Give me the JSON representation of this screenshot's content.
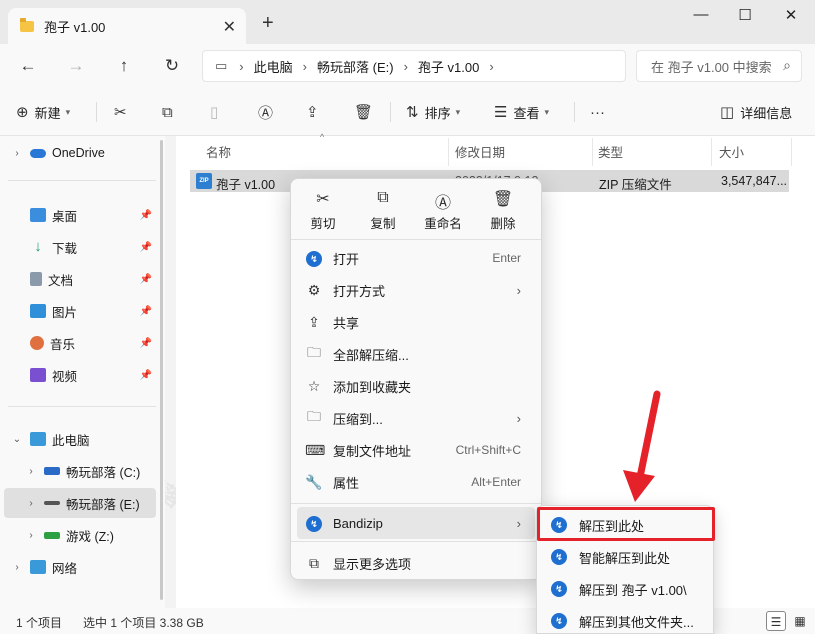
{
  "window": {
    "tab_title": "孢子 v1.00",
    "new_tab": "+",
    "controls": {
      "minimize": "—",
      "maximize": "☐",
      "close": "✕"
    }
  },
  "nav": {
    "back": "←",
    "forward": "→",
    "up": "↑",
    "refresh": "↻",
    "breadcrumbs": [
      "此电脑",
      "畅玩部落 (E:)",
      "孢子 v1.00"
    ],
    "search_placeholder": "在 孢子 v1.00 中搜索"
  },
  "commands": {
    "new": "新建",
    "sort": "排序",
    "view": "查看",
    "details": "详细信息"
  },
  "sidebar": {
    "onedrive": "OneDrive",
    "quick": [
      {
        "label": "桌面",
        "icon": "desktop-icon",
        "color": "#3b8ede"
      },
      {
        "label": "下载",
        "icon": "download-icon",
        "color": "#1f9e6a"
      },
      {
        "label": "文档",
        "icon": "document-icon",
        "color": "#7a8b9b"
      },
      {
        "label": "图片",
        "icon": "pictures-icon",
        "color": "#2f8fd8"
      },
      {
        "label": "音乐",
        "icon": "music-icon",
        "color": "#e07040"
      },
      {
        "label": "视频",
        "icon": "video-icon",
        "color": "#7a4fd0"
      }
    ],
    "this_pc": "此电脑",
    "drives": [
      {
        "label": "畅玩部落 (C:)",
        "selected": false
      },
      {
        "label": "畅玩部落 (E:)",
        "selected": true
      },
      {
        "label": "游戏 (Z:)",
        "selected": false
      }
    ],
    "network": "网络"
  },
  "filelist": {
    "columns": [
      "名称",
      "修改日期",
      "类型",
      "大小"
    ],
    "rows": [
      {
        "name": "孢子 v1.00",
        "date": "2023/1/17 9:13",
        "type": "ZIP 压缩文件",
        "size": "3,547,847..."
      }
    ]
  },
  "context_menu": {
    "quick_actions": [
      {
        "icon": "cut-icon",
        "label": "剪切",
        "glyph": "✂"
      },
      {
        "icon": "copy-icon",
        "label": "复制",
        "glyph": "⧉"
      },
      {
        "icon": "rename-icon",
        "label": "重命名",
        "glyph": "Ⓐ"
      },
      {
        "icon": "delete-icon",
        "label": "删除",
        "glyph": "🗑"
      }
    ],
    "items": [
      {
        "label": "打开",
        "shortcut": "Enter"
      },
      {
        "label": "打开方式",
        "shortcut": ""
      },
      {
        "label": "共享",
        "shortcut": ""
      },
      {
        "label": "全部解压缩...",
        "shortcut": ""
      },
      {
        "label": "添加到收藏夹",
        "shortcut": ""
      },
      {
        "label": "压缩到...",
        "shortcut": ""
      },
      {
        "label": "复制文件地址",
        "shortcut": "Ctrl+Shift+C"
      },
      {
        "label": "属性",
        "shortcut": "Alt+Enter"
      }
    ],
    "bandizip": "Bandizip",
    "more": "显示更多选项"
  },
  "submenu": {
    "items": [
      "解压到此处",
      "智能解压到此处",
      "解压到 孢子 v1.00\\",
      "解压到其他文件夹..."
    ]
  },
  "status": {
    "count": "1 个项目",
    "selected": "选中 1 个项目  3.38 GB"
  },
  "watermark": "畅玩部落",
  "colors": {
    "accent": "#1f6fd1",
    "highlight_box": "#e5212a",
    "selected_row": "#d9d9d9"
  }
}
